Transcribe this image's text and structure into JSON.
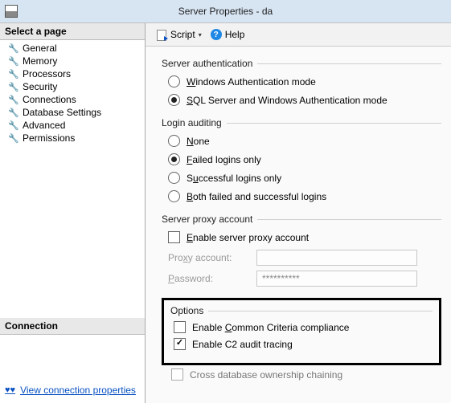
{
  "window": {
    "title": "Server Properties - da"
  },
  "sidebar": {
    "select_header": "Select a page",
    "connection_header": "Connection",
    "view_conn_link": "View connection properties",
    "pages": [
      {
        "label": "General"
      },
      {
        "label": "Memory"
      },
      {
        "label": "Processors"
      },
      {
        "label": "Security"
      },
      {
        "label": "Connections"
      },
      {
        "label": "Database Settings"
      },
      {
        "label": "Advanced"
      },
      {
        "label": "Permissions"
      }
    ]
  },
  "toolbar": {
    "script_label": "Script",
    "help_label": "Help"
  },
  "auth": {
    "legend": "Server authentication",
    "windows_mode_pre": "",
    "windows_mode_key": "W",
    "windows_mode_post": "indows Authentication mode",
    "sql_mode_pre": "",
    "sql_mode_key": "S",
    "sql_mode_post": "QL Server and Windows Authentication mode"
  },
  "audit": {
    "legend": "Login auditing",
    "none_key": "N",
    "none_post": "one",
    "failed_pre": "",
    "failed_key": "F",
    "failed_post": "ailed logins only",
    "success_pre": "S",
    "success_key": "u",
    "success_post": "ccessful logins only",
    "both_pre": "",
    "both_key": "B",
    "both_post": "oth failed and successful logins"
  },
  "proxy": {
    "legend": "Server proxy account",
    "enable_pre": "",
    "enable_key": "E",
    "enable_post": "nable server proxy account",
    "account_label_pre": "Pro",
    "account_label_key": "x",
    "account_label_post": "y account:",
    "account_value": "",
    "password_label_pre": "",
    "password_label_key": "P",
    "password_label_post": "assword:",
    "password_value": "**********"
  },
  "options": {
    "legend": "Options",
    "ccc_pre": "Enable ",
    "ccc_key": "C",
    "ccc_post": "ommon Criteria compliance",
    "c2_pre": "Enable C2 audit tracin",
    "c2_key": "g",
    "c2_post": "",
    "crossdb_label": "Cross database ownership chaining"
  }
}
